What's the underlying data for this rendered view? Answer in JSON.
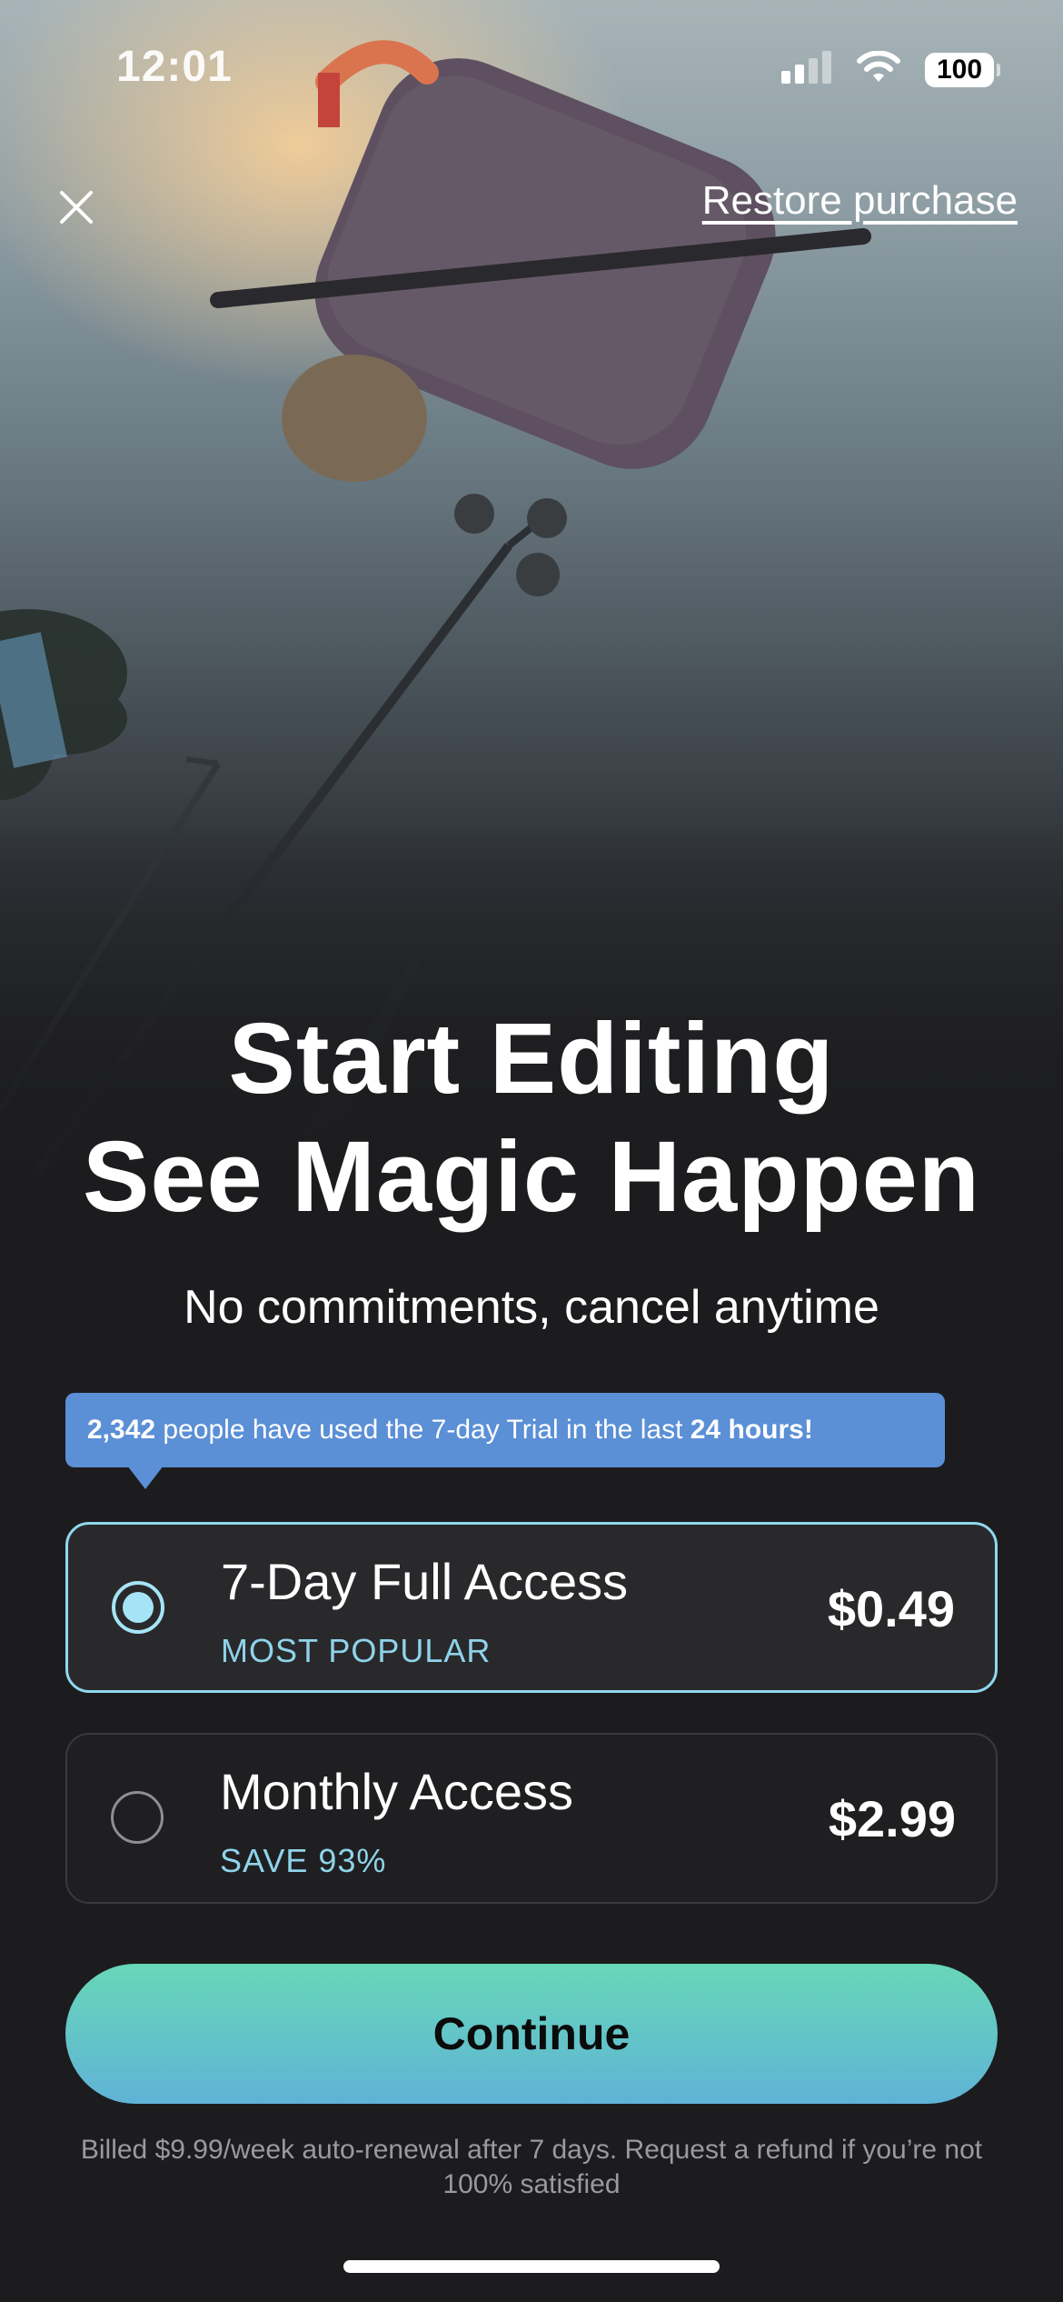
{
  "status_bar": {
    "time": "12:01",
    "battery": "100"
  },
  "header": {
    "close_icon": "close-icon",
    "restore_label": "Restore purchase"
  },
  "headline": {
    "line1": "Start Editing",
    "line2": "See Magic Happen"
  },
  "subheadline": "No commitments, cancel anytime",
  "social_proof": {
    "count": "2,342",
    "middle": " people have used the 7-day Trial in the last ",
    "period": "24 hours!"
  },
  "plans": [
    {
      "title": "7-Day Full Access",
      "tag": "MOST POPULAR",
      "price": "$0.49",
      "selected": true
    },
    {
      "title": "Monthly Access",
      "tag": "SAVE 93%",
      "price": "$2.99",
      "selected": false
    }
  ],
  "cta": {
    "label": "Continue"
  },
  "legal": "Billed $9.99/week auto-renewal after 7 days. Request a refund if you’re not 100% satisfied",
  "colors": {
    "accent": "#8fd8ee",
    "proof_bg": "#5b8fd6",
    "cta_top": "#68d7b8",
    "cta_bottom": "#5fb3d6",
    "background": "#1c1c1e"
  }
}
